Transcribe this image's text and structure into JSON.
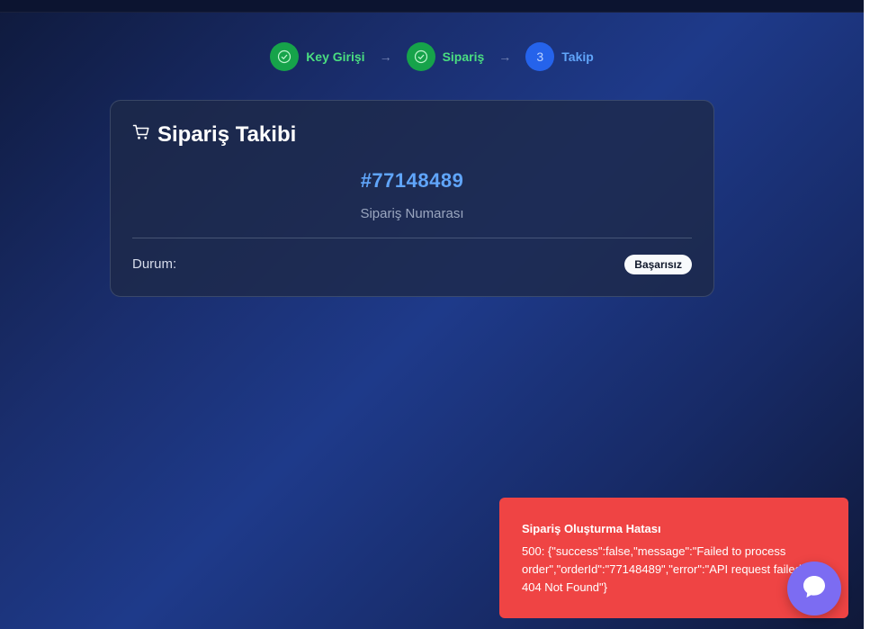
{
  "stepper": {
    "steps": [
      {
        "label": "Key Girişi",
        "state": "done"
      },
      {
        "label": "Sipariş",
        "state": "done"
      },
      {
        "label": "Takip",
        "state": "active",
        "number": "3"
      }
    ]
  },
  "card": {
    "title": "Sipariş Takibi",
    "icon": "cart-icon",
    "order_number": "#77148489",
    "order_caption": "Sipariş Numarası",
    "status_label": "Durum:",
    "status_value": "Başarısız"
  },
  "toast": {
    "title": "Sipariş Oluşturma Hatası",
    "body": "500: {\"success\":false,\"message\":\"Failed to process order\",\"orderId\":\"77148489\",\"error\":\"API request failed: 404 Not Found\"}"
  },
  "chat": {
    "icon": "chat-bubble-icon"
  },
  "colors": {
    "done": "#16a34a",
    "active": "#2563eb",
    "accent": "#60a5fa",
    "error": "#ef4444",
    "chat": "#7c6cf2"
  }
}
